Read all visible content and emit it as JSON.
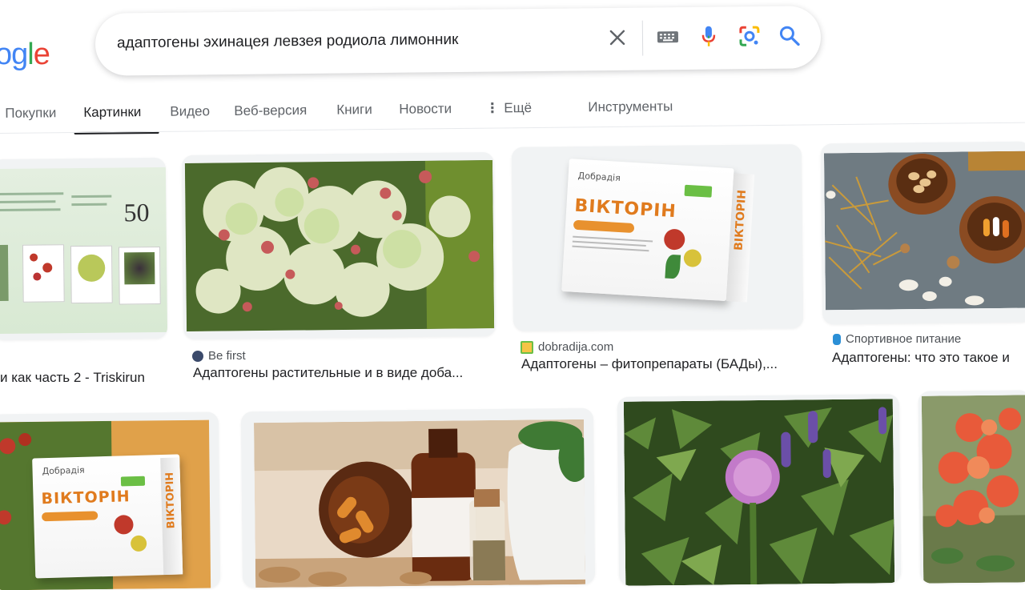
{
  "logo": {
    "text": "ogle",
    "letters": [
      "o",
      "g",
      "l",
      "e"
    ]
  },
  "search": {
    "query": "адаптогены эхинацея левзея родиола лимонник",
    "clear_icon": "close-icon",
    "keyboard_icon": "keyboard-icon",
    "mic_icon": "microphone-icon",
    "lens_icon": "camera-lens-icon",
    "search_icon": "search-icon"
  },
  "tabs": {
    "items": [
      {
        "label": "Покупки"
      },
      {
        "label": "Картинки",
        "active": true
      },
      {
        "label": "Видео"
      },
      {
        "label": "Веб-версия"
      },
      {
        "label": "Книги"
      },
      {
        "label": "Новости"
      },
      {
        "label": "Ещё"
      }
    ],
    "tools": "Инструменты"
  },
  "results": [
    {
      "source": "",
      "title": "и как часть 2 - Triskirun",
      "poster_number": "50"
    },
    {
      "source": "Be first",
      "title": "Адаптогены растительные и в виде доба..."
    },
    {
      "source": "dobradija.com",
      "title": "Адаптогены – фитопрепараты (БАДы),...",
      "box_title": "ВІКТОРІН",
      "box_brand": "Добрадія"
    },
    {
      "source": "Спортивное питание",
      "title": "Адаптогены: что это такое и"
    },
    {
      "box_title": "ВІКТОРІН",
      "box_brand": "Добрадія"
    }
  ],
  "colors": {
    "blue": "#4285f4",
    "red": "#ea4335",
    "yellow": "#fbbc05",
    "green": "#34a853",
    "muted": "#5f6368",
    "orange": "#e07b1e"
  }
}
